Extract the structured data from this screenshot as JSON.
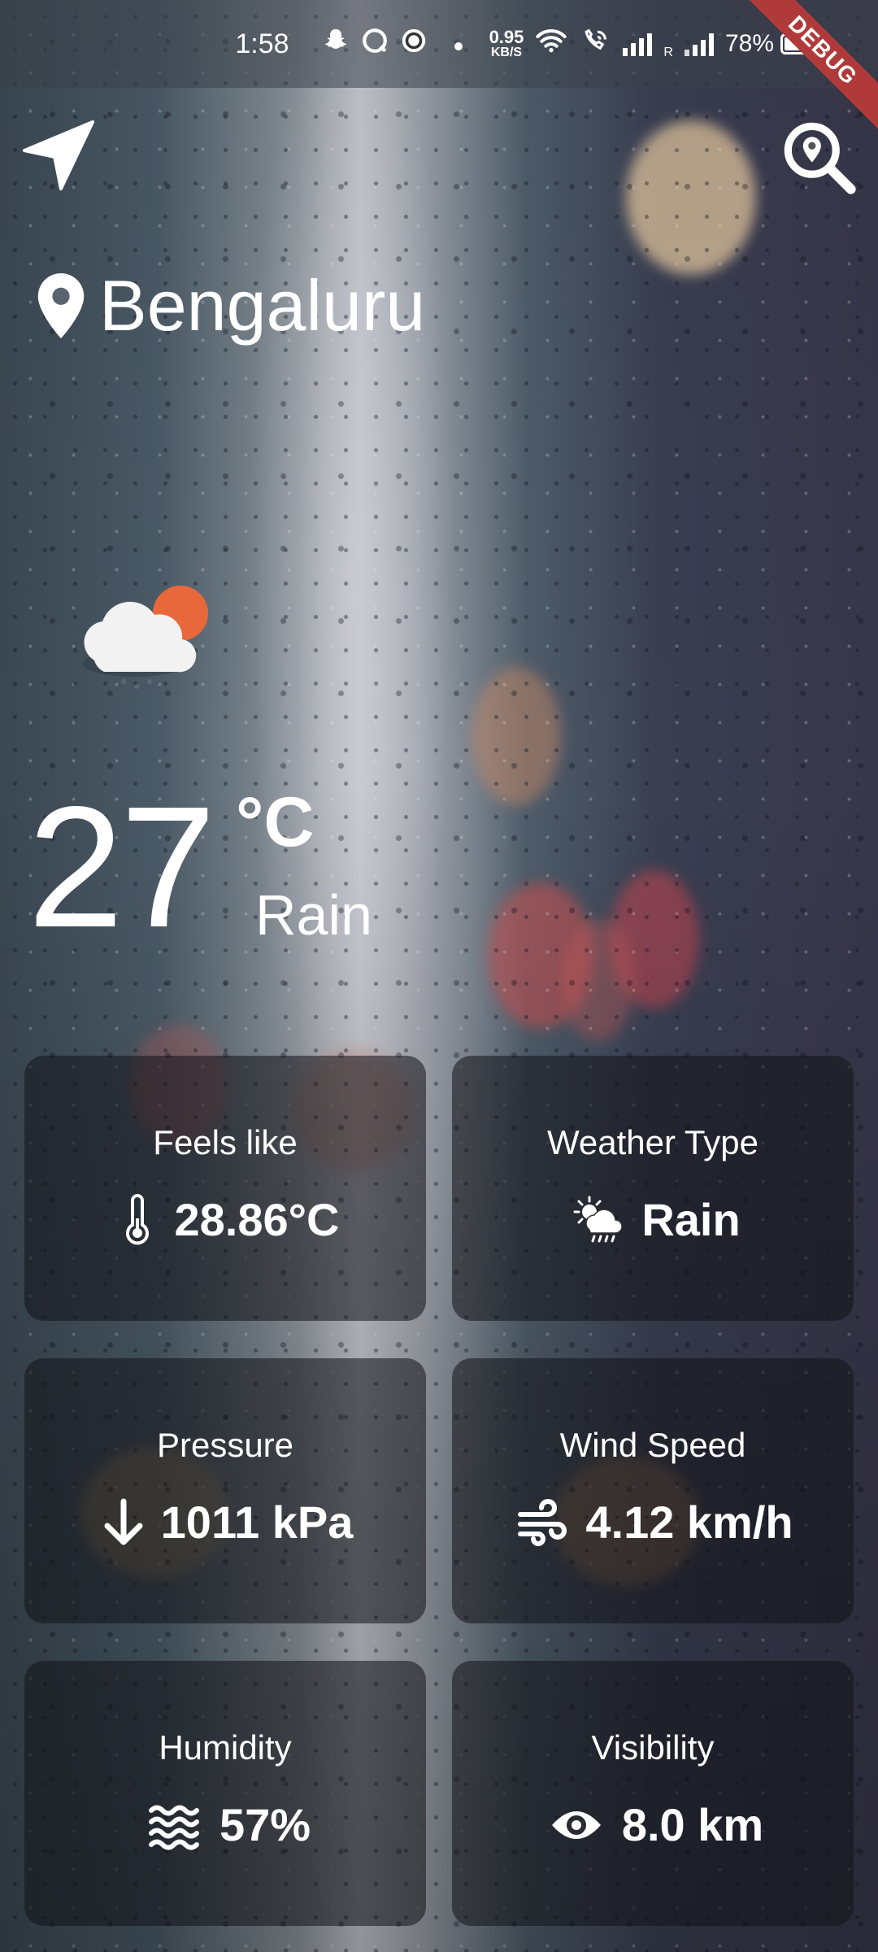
{
  "status_bar": {
    "time": "1:58",
    "net_speed_value": "0.95",
    "net_speed_unit": "KB/S",
    "battery_percent_label": "78%",
    "battery_level": 0.78,
    "roaming_label": "R"
  },
  "debug_banner": "DEBUG",
  "location": {
    "city": "Bengaluru"
  },
  "current": {
    "temperature": "27",
    "unit": "°C",
    "condition": "Rain"
  },
  "cards": [
    {
      "label": "Feels like",
      "value": "28.86°C",
      "icon": "thermometer-icon"
    },
    {
      "label": "Weather Type",
      "value": "Rain",
      "icon": "sun-cloud-rain-icon"
    },
    {
      "label": "Pressure",
      "value": "1011 kPa",
      "icon": "arrow-down-icon"
    },
    {
      "label": "Wind Speed",
      "value": "4.12 km/h",
      "icon": "wind-icon"
    },
    {
      "label": "Humidity",
      "value": "57%",
      "icon": "water-waves-icon"
    },
    {
      "label": "Visibility",
      "value": "8.0 km",
      "icon": "eye-icon"
    }
  ],
  "colors": {
    "card_bg": "rgba(18,18,24,0.55)",
    "sun": "#e8683c",
    "debug_banner": "#b03a3a"
  }
}
